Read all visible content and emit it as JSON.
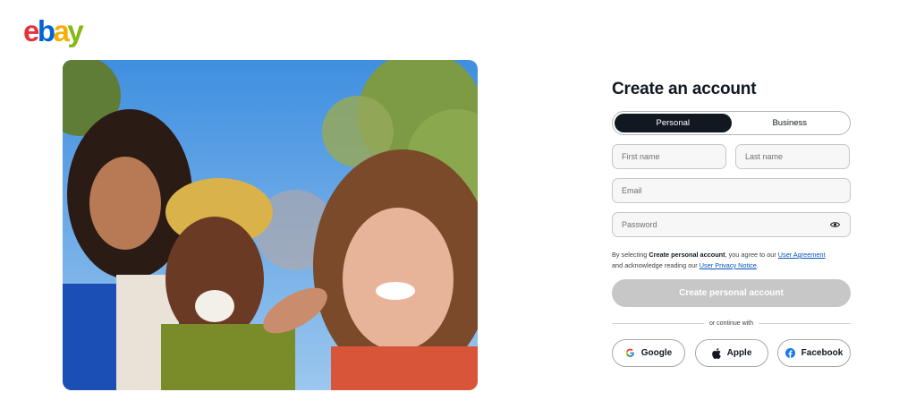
{
  "brand": {
    "logo_letters": [
      "e",
      "b",
      "a",
      "y"
    ],
    "logo_colors": [
      "#e53238",
      "#0064d2",
      "#f5af02",
      "#86b817"
    ]
  },
  "hero": {
    "icon": "people-photo-icon"
  },
  "form": {
    "title": "Create an account",
    "account_types": [
      "Personal",
      "Business"
    ],
    "selected_account_type": "Personal",
    "first_name_placeholder": "First name",
    "last_name_placeholder": "Last name",
    "email_placeholder": "Email",
    "password_placeholder": "Password",
    "password_toggle_icon": "eye-icon",
    "legal": {
      "prefix": "By selecting ",
      "bold": "Create personal account",
      "middle": ", you agree to our ",
      "agreement_link": "User Agreement",
      "second_line": "and acknowledge reading our ",
      "privacy_link": "User Privacy Notice",
      "suffix": "."
    },
    "submit_label": "Create personal account",
    "divider_text": "or continue with",
    "social": [
      {
        "label": "Google",
        "icon": "google-icon"
      },
      {
        "label": "Apple",
        "icon": "apple-icon"
      },
      {
        "label": "Facebook",
        "icon": "facebook-icon"
      }
    ]
  },
  "colors": {
    "primary_dark": "#111820",
    "disabled_button": "#c7c7c7",
    "link": "#0654ba",
    "facebook_blue": "#1877f2"
  }
}
